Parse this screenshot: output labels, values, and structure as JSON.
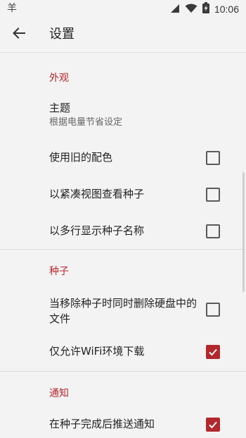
{
  "status_bar": {
    "time": "10:06",
    "left_icon": "android-debug-icon",
    "icons": [
      "signal-icon",
      "wifi-icon",
      "battery-charging-icon"
    ]
  },
  "toolbar": {
    "title": "设置",
    "back_icon": "arrow-back-icon"
  },
  "colors": {
    "accent": "#b3282d",
    "background": "#f3f3f3"
  },
  "sections": {
    "appearance": {
      "header": "外观",
      "theme": {
        "title": "主题",
        "summary": "根据电量节省设定"
      },
      "old_colors": {
        "title": "使用旧的配色",
        "checked": false
      },
      "compact_view": {
        "title": "以紧凑视图查看种子",
        "checked": false
      },
      "multiline_names": {
        "title": "以多行显示种子名称",
        "checked": false
      }
    },
    "torrents": {
      "header": "种子",
      "delete_files": {
        "title": "当移除种子时同时删除硬盘中的文件",
        "checked": false
      },
      "wifi_only": {
        "title": "仅允许WiFi环境下载",
        "checked": true
      }
    },
    "notifications": {
      "header": "通知",
      "notify_complete": {
        "title": "在种子完成后推送通知",
        "checked": true
      }
    }
  }
}
